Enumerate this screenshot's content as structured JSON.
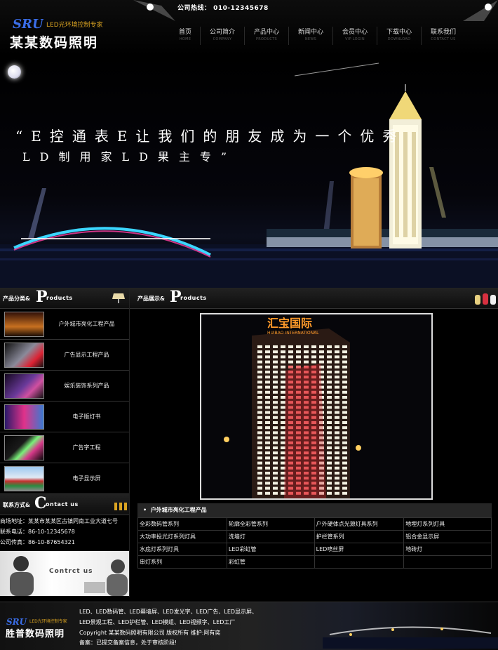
{
  "header": {
    "hotline": "公司热线： 010-12345678",
    "logo_mark": "SRU",
    "logo_tagline": "LED光环境控制专家",
    "logo_name": "某某数码照明",
    "nav": [
      {
        "cn": "首页",
        "en": "HOME"
      },
      {
        "cn": "公司简介",
        "en": "COMPANY"
      },
      {
        "cn": "产品中心",
        "en": "PRODUCTS"
      },
      {
        "cn": "新闻中心",
        "en": "NEWS"
      },
      {
        "cn": "会员中心",
        "en": "VIP LOGIN"
      },
      {
        "cn": "下载中心",
        "en": "DOWNLOAD"
      },
      {
        "cn": "联系我们",
        "en": "CONTACT US"
      }
    ]
  },
  "banner": {
    "slogan_line1": "“E控通表E让我们的朋友成为一个优秀",
    "slogan_line2": "LD制用家LD果主专”"
  },
  "sidebar": {
    "products_head": {
      "cn": "产品分类&",
      "big": "P",
      "en": "roducts"
    },
    "categories": [
      "户外城市亮化工程产品",
      "广告显示工程产品",
      "娱乐装饰系列产品",
      "电子版灯书",
      "广告字工程",
      "电子显示屏"
    ],
    "contact_head": {
      "cn": "联系方式&",
      "big": "C",
      "en": "ontact us"
    },
    "contact": {
      "address": "商场地址：某某市某某区古镇同南工业大道七号",
      "phone": "联系电话：86-10-12345678",
      "fax": "公司传真：86-10-87654321"
    },
    "contact_banner": "Contrct us"
  },
  "main": {
    "products_head": {
      "cn": "产品展示&",
      "big": "P",
      "en": "roducts"
    },
    "photo_sign_cn": "汇宝国际",
    "photo_sign_en": "HUIBAO INTERNATIONAL",
    "list_title": "户外城市亮化工程产品",
    "products": [
      [
        "全彩数码管系列",
        "轮廓全彩管系列",
        "户外硬体点光源灯具系列",
        "地埋灯系列灯具"
      ],
      [
        "大功率投光灯系列灯具",
        "洗墙灯",
        "护栏管系列",
        "铝合金显示屏"
      ],
      [
        "水底灯系列灯具",
        "LED彩虹管",
        "LED喷丝屏",
        "地砖灯"
      ],
      [
        "串灯系列",
        "彩虹管",
        "",
        ""
      ]
    ]
  },
  "footer": {
    "logo_mark": "SRU",
    "tagline": "LED光环境控制专家",
    "name": "胜普数码照明",
    "line1": "LED、LED数码管、LED幕墙屏、LED发光字、LED广告、LED显示屏、",
    "line2": "LED景观工程、LED护栏管、LED模组、LED视频字、LED工厂",
    "line3": "Copyright 某某数码照明有限公司 版权所有 维护:阿有奕",
    "line4": "备案：已提交备案信息，处于审核阶段!"
  }
}
